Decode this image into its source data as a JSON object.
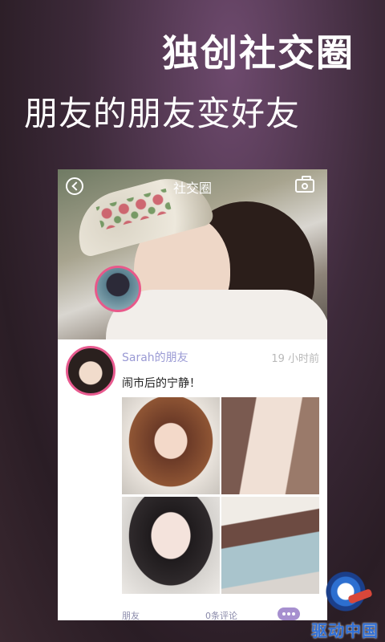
{
  "promo": {
    "title": "独创社交圈",
    "subtitle": "朋友的朋友变好友"
  },
  "app": {
    "topbar": {
      "title": "社交圈",
      "back_icon": "back-circle-icon",
      "camera_icon": "camera-icon"
    },
    "post": {
      "author": "Sarah的朋友",
      "time": "19 小时前",
      "text": "闹市后的宁静！",
      "photo_count": 4,
      "footer": {
        "friends_label": "朋友",
        "comments_label": "0条评论"
      },
      "more_icon": "more-dots-icon"
    }
  },
  "watermark": {
    "text": "驱动中国"
  },
  "colors": {
    "accent_pink": "#e85a8f",
    "author_purple": "#9a9ad4",
    "more_button": "#a68fcf"
  }
}
